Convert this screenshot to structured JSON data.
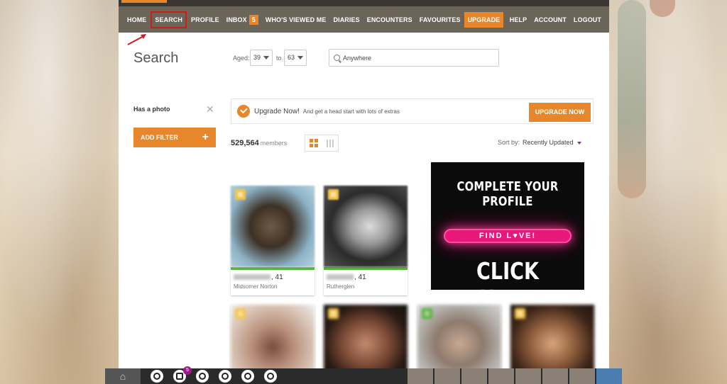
{
  "nav": {
    "home": "HOME",
    "search": "SEARCH",
    "profile": "PROFILE",
    "inbox": "INBOX",
    "inbox_count": "5",
    "viewed": "WHO'S VIEWED ME",
    "diaries": "DIARIES",
    "encounters": "ENCOUNTERS",
    "favourites": "FAVOURITES",
    "upgrade": "UPGRADE",
    "help": "HELP",
    "account": "ACCOUNT",
    "logout": "LOGOUT"
  },
  "search": {
    "title": "Search",
    "aged_label": "Aged:",
    "age_min": "39",
    "to_label": "to",
    "age_max": "63",
    "location": "Anywhere"
  },
  "filters": {
    "has_photo": "Has a photo",
    "add_filter": "ADD FILTER"
  },
  "upgrade_banner": {
    "title": "Upgrade Now!",
    "text": "And get a head start with lots of extras",
    "button": "UPGRADE NOW"
  },
  "results": {
    "count": "529,564",
    "count_label": "members",
    "sort_label": "Sort by:",
    "sort_value": "Recently Updated"
  },
  "profiles": [
    {
      "age": ", 41",
      "location": "Midsomer Norton"
    },
    {
      "age": ", 41",
      "location": "Rutherglen"
    }
  ],
  "ad": {
    "line1": "COMPLETE YOUR PROFILE",
    "pill": "FIND L♥VE!",
    "line3": "CLICK HERE"
  },
  "taskbar": {
    "message_count": "5"
  },
  "colors": {
    "accent": "#e8862b",
    "nav_bg": "#6b6459",
    "online_bar": "#55b53a",
    "highlight_box": "#d11b1b"
  }
}
